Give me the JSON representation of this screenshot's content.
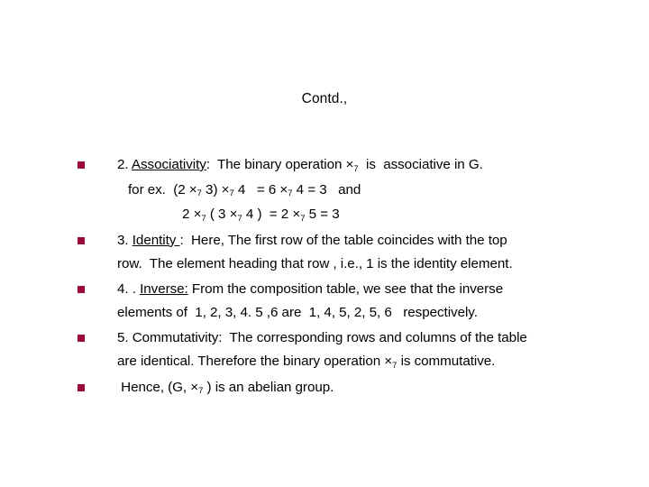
{
  "slide": {
    "title": "Contd.,",
    "background_color": "#FFFFFF",
    "text_color": "#000000",
    "bullet_color": "#9B0B3A",
    "bullet_glyph": "square-bullet"
  },
  "bullets": [
    {
      "id": "associativity",
      "number": "2.",
      "heading": "Associativity",
      "heading_underlined": true,
      "lines": [
        {
          "id": "assoc-line-1",
          "text": "2. Associativity:  The binary operation ×₇  is  associative in G."
        },
        {
          "id": "assoc-line-2",
          "text": "for ex.  (2 ×₇ 3) ×₇ 4   = 6 ×₇ 4 = 3   and"
        },
        {
          "id": "assoc-line-3",
          "text": "2 ×₇ ( 3 ×₇ 4 )  = 2 ×₇ 5 = 3"
        }
      ]
    },
    {
      "id": "identity",
      "number": "3.",
      "heading": "Identity ",
      "heading_underlined": true,
      "lines": [
        {
          "id": "identity-line-1",
          "text": "3. Identity :  Here, The first row of the table coincides with the top"
        },
        {
          "id": "identity-line-2",
          "text": "row.  The element heading that row , i.e., 1 is the identity element."
        }
      ]
    },
    {
      "id": "inverse",
      "number": "4. .",
      "heading": "Inverse:",
      "heading_underlined": true,
      "lines": [
        {
          "id": "inverse-line-1",
          "text": "4. . Inverse: From the composition table, we see that the inverse"
        },
        {
          "id": "inverse-line-2",
          "text": "elements of  1, 2, 3, 4. 5 ,6 are  1, 4, 5, 2, 5, 6   respectively."
        }
      ]
    },
    {
      "id": "commutativity",
      "number": "5.",
      "heading": "Commutativity:",
      "heading_underlined": false,
      "lines": [
        {
          "id": "commutativity-line-1",
          "text": "5. Commutativity:  The corresponding rows and columns of the table"
        },
        {
          "id": "commutativity-line-2",
          "text": "are identical. Therefore the binary operation ×₇ is commutative."
        }
      ]
    },
    {
      "id": "conclusion",
      "number": "",
      "heading": "",
      "heading_underlined": false,
      "lines": [
        {
          "id": "conclusion-line-1",
          "text": " Hence, (G, ×₇ ) is an abelian group."
        }
      ]
    }
  ],
  "text_fragments": {
    "assoc_num": "2.",
    "assoc_heading": "Associativity",
    "assoc_colon_rest": ":  The binary operation ",
    "assoc_op": "×",
    "assoc_sub": "7",
    "assoc_tail": "  is  associative in G.",
    "assoc_ex_a": "for ex.  (2 ",
    "assoc_ex_b": " 3) ",
    "assoc_ex_c": " 4   = 6 ",
    "assoc_ex_d": " 4 = 3   and",
    "assoc_ex2_a": "2 ",
    "assoc_ex2_b": " ( 3 ",
    "assoc_ex2_c": " 4 )  = 2 ",
    "assoc_ex2_d": " 5 = 3",
    "identity_num": "3.",
    "identity_heading": "Identity ",
    "identity_rest": ":  Here, The first row of the table coincides with the top",
    "identity_line2": "row.  The element heading that row , i.e., 1 is the identity element.",
    "inverse_num": "4. .",
    "inverse_heading": "Inverse:",
    "inverse_rest": " From the composition table, we see that the inverse",
    "inverse_line2": "elements of  1, 2, 3, 4. 5 ,6 are  1, 4, 5, 2, 5, 6   respectively.",
    "comm_line1": "5. Commutativity:  The corresponding rows and columns of the table",
    "comm_line2_a": "are identical. Therefore the binary operation ",
    "comm_line2_b": " is commutative.",
    "concl_a": " Hence, (G, ",
    "concl_b": " ) is an abelian group."
  }
}
